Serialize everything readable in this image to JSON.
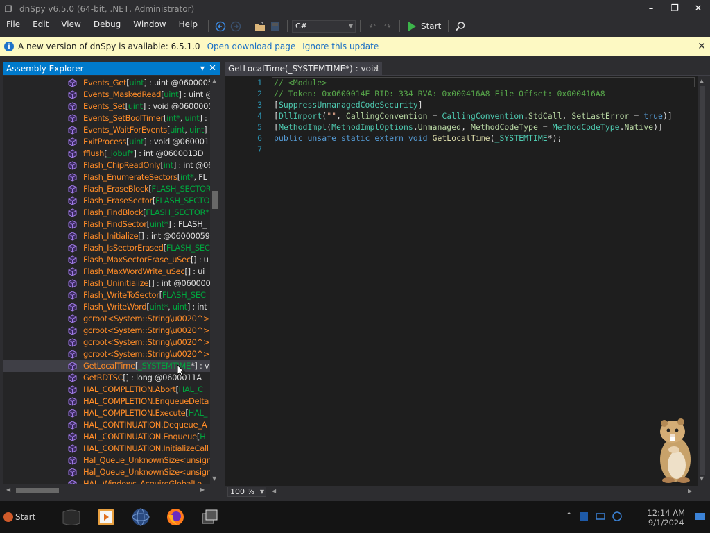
{
  "window": {
    "title": "dnSpy v6.5.0 (64-bit, .NET, Administrator)",
    "minimize": "–",
    "maximize": "❐",
    "close": "✕"
  },
  "menu": [
    "File",
    "Edit",
    "View",
    "Debug",
    "Window",
    "Help"
  ],
  "toolbar": {
    "language": "C#",
    "start_label": "Start"
  },
  "infobar": {
    "message": "A new version of dnSpy is available: 6.5.1.0",
    "download_link": "Open download page",
    "ignore_link": "Ignore this update"
  },
  "assembly_explorer": {
    "title": "Assembly Explorer",
    "rows": [
      {
        "parts": [
          [
            "o",
            "Events_Get"
          ],
          [
            "w",
            "["
          ],
          [
            "g",
            "uint"
          ],
          [
            "w",
            "] : uint @0600005"
          ]
        ]
      },
      {
        "parts": [
          [
            "o",
            "Events_MaskedRead"
          ],
          [
            "w",
            "["
          ],
          [
            "g",
            "uint"
          ],
          [
            "w",
            "] : uint @"
          ]
        ]
      },
      {
        "parts": [
          [
            "o",
            "Events_Set"
          ],
          [
            "w",
            "["
          ],
          [
            "g",
            "uint"
          ],
          [
            "w",
            "] : void @0600005"
          ]
        ]
      },
      {
        "parts": [
          [
            "o",
            "Events_SetBoolTimer"
          ],
          [
            "w",
            "["
          ],
          [
            "g",
            "int*"
          ],
          [
            "w",
            ", "
          ],
          [
            "g",
            "uint"
          ],
          [
            "w",
            "] :"
          ]
        ]
      },
      {
        "parts": [
          [
            "o",
            "Events_WaitForEvents"
          ],
          [
            "w",
            "["
          ],
          [
            "g",
            "uint"
          ],
          [
            "w",
            ", "
          ],
          [
            "g",
            "uint"
          ],
          [
            "w",
            "] :"
          ]
        ]
      },
      {
        "parts": [
          [
            "o",
            "ExitProcess"
          ],
          [
            "w",
            "["
          ],
          [
            "g",
            "uint"
          ],
          [
            "w",
            "] : void @060001"
          ]
        ]
      },
      {
        "parts": [
          [
            "o",
            "fflush"
          ],
          [
            "w",
            "["
          ],
          [
            "g",
            "_iobuf*"
          ],
          [
            "w",
            "] : int @0600013D"
          ]
        ]
      },
      {
        "parts": [
          [
            "o",
            "Flash_ChipReadOnly"
          ],
          [
            "w",
            "["
          ],
          [
            "g",
            "int"
          ],
          [
            "w",
            "] : int @06"
          ]
        ]
      },
      {
        "parts": [
          [
            "o",
            "Flash_EnumerateSectors"
          ],
          [
            "w",
            "["
          ],
          [
            "g",
            "int*"
          ],
          [
            "w",
            ", FL"
          ]
        ]
      },
      {
        "parts": [
          [
            "o",
            "Flash_EraseBlock"
          ],
          [
            "w",
            "["
          ],
          [
            "g",
            "FLASH_SECTOR"
          ]
        ]
      },
      {
        "parts": [
          [
            "o",
            "Flash_EraseSector"
          ],
          [
            "w",
            "["
          ],
          [
            "g",
            "FLASH_SECTO"
          ]
        ]
      },
      {
        "parts": [
          [
            "o",
            "Flash_FindBlock"
          ],
          [
            "w",
            "["
          ],
          [
            "g",
            "FLASH_SECTOR*"
          ]
        ]
      },
      {
        "parts": [
          [
            "o",
            "Flash_FindSector"
          ],
          [
            "w",
            "["
          ],
          [
            "g",
            "uint*"
          ],
          [
            "w",
            "] : FLASH_"
          ]
        ]
      },
      {
        "parts": [
          [
            "o",
            "Flash_Initialize"
          ],
          [
            "w",
            "[] : int @06000059"
          ]
        ]
      },
      {
        "parts": [
          [
            "o",
            "Flash_IsSectorErased"
          ],
          [
            "w",
            "["
          ],
          [
            "g",
            "FLASH_SEC"
          ]
        ]
      },
      {
        "parts": [
          [
            "o",
            "Flash_MaxSectorErase_uSec"
          ],
          [
            "w",
            "[] : u"
          ]
        ]
      },
      {
        "parts": [
          [
            "o",
            "Flash_MaxWordWrite_uSec"
          ],
          [
            "w",
            "[] : ui"
          ]
        ]
      },
      {
        "parts": [
          [
            "o",
            "Flash_Uninitialize"
          ],
          [
            "w",
            "[] : int @0600000"
          ]
        ]
      },
      {
        "parts": [
          [
            "o",
            "Flash_WriteToSector"
          ],
          [
            "w",
            "["
          ],
          [
            "g",
            "FLASH_SEC"
          ]
        ]
      },
      {
        "parts": [
          [
            "o",
            "Flash_WriteWord"
          ],
          [
            "w",
            "["
          ],
          [
            "g",
            "uint*"
          ],
          [
            "w",
            ", "
          ],
          [
            "g",
            "uint"
          ],
          [
            "w",
            "] : int"
          ]
        ]
      },
      {
        "parts": [
          [
            "o",
            "gcroot<System::String\\u0020^>"
          ]
        ]
      },
      {
        "parts": [
          [
            "o",
            "gcroot<System::String\\u0020^>."
          ]
        ]
      },
      {
        "parts": [
          [
            "o",
            "gcroot<System::String\\u0020^>"
          ]
        ]
      },
      {
        "parts": [
          [
            "o",
            "gcroot<System::String\\u0020^>."
          ]
        ]
      },
      {
        "parts": [
          [
            "o",
            "GetLocalTime"
          ],
          [
            "w",
            "["
          ],
          [
            "g",
            "_SYSTEMTIME"
          ],
          [
            "w",
            "*] : v"
          ]
        ],
        "selected": true
      },
      {
        "parts": [
          [
            "o",
            "GetRDTSC"
          ],
          [
            "w",
            "[] : long @0600011A"
          ]
        ]
      },
      {
        "parts": [
          [
            "o",
            "HAL_COMPLETION.Abort"
          ],
          [
            "w",
            "["
          ],
          [
            "g",
            "HAL_C"
          ]
        ]
      },
      {
        "parts": [
          [
            "o",
            "HAL_COMPLETION.EnqueueDelta"
          ]
        ]
      },
      {
        "parts": [
          [
            "o",
            "HAL_COMPLETION.Execute"
          ],
          [
            "w",
            "["
          ],
          [
            "g",
            "HAL_"
          ]
        ]
      },
      {
        "parts": [
          [
            "o",
            "HAL_CONTINUATION.Dequeue_A"
          ]
        ]
      },
      {
        "parts": [
          [
            "o",
            "HAL_CONTINUATION.Enqueue"
          ],
          [
            "w",
            "["
          ],
          [
            "g",
            "H"
          ]
        ]
      },
      {
        "parts": [
          [
            "o",
            "HAL_CONTINUATION.InitializeCall"
          ]
        ]
      },
      {
        "parts": [
          [
            "o",
            "Hal_Queue_UnknownSize<unsign"
          ]
        ]
      },
      {
        "parts": [
          [
            "o",
            "Hal_Queue_UnknownSize<unsign"
          ]
        ]
      },
      {
        "parts": [
          [
            "o",
            "HAL_Windows_AcquireGlobalLo"
          ]
        ]
      }
    ]
  },
  "document_tab": {
    "title": "GetLocalTime(_SYSTEMTIME*) : void",
    "close": "✕"
  },
  "code": {
    "lines": [
      {
        "n": "1",
        "tokens": [
          [
            "com",
            "// <Module>"
          ]
        ]
      },
      {
        "n": "2",
        "tokens": [
          [
            "com",
            "// Token: 0x0600014E RID: 334 RVA: 0x000416A8 File Offset: 0x000416A8"
          ]
        ]
      },
      {
        "n": "3",
        "tokens": [
          [
            "def",
            "["
          ],
          [
            "teal",
            "SuppressUnmanagedCodeSecurity"
          ],
          [
            "def",
            "]"
          ]
        ]
      },
      {
        "n": "4",
        "tokens": [
          [
            "def",
            "["
          ],
          [
            "teal",
            "DllImport"
          ],
          [
            "def",
            "("
          ],
          [
            "str",
            "\"\""
          ],
          [
            "def",
            ", "
          ],
          [
            "purple",
            "CallingConvention"
          ],
          [
            "def",
            " = "
          ],
          [
            "teal",
            "CallingConvention"
          ],
          [
            "def",
            "."
          ],
          [
            "enum",
            "StdCall"
          ],
          [
            "def",
            ", "
          ],
          [
            "purple",
            "SetLastError"
          ],
          [
            "def",
            " = "
          ],
          [
            "blue",
            "true"
          ],
          [
            "def",
            ")]"
          ]
        ]
      },
      {
        "n": "5",
        "tokens": [
          [
            "def",
            "["
          ],
          [
            "teal",
            "MethodImpl"
          ],
          [
            "def",
            "("
          ],
          [
            "teal",
            "MethodImplOptions"
          ],
          [
            "def",
            "."
          ],
          [
            "enum",
            "Unmanaged"
          ],
          [
            "def",
            ", "
          ],
          [
            "purple",
            "MethodCodeType"
          ],
          [
            "def",
            " = "
          ],
          [
            "teal",
            "MethodCodeType"
          ],
          [
            "def",
            "."
          ],
          [
            "enum",
            "Native"
          ],
          [
            "def",
            ")]"
          ]
        ]
      },
      {
        "n": "6",
        "tokens": [
          [
            "blue",
            "public unsafe static extern void "
          ],
          [
            "meth",
            "GetLocalTime"
          ],
          [
            "def",
            "("
          ],
          [
            "green",
            "_SYSTEMTIME"
          ],
          [
            "def",
            "*);"
          ]
        ]
      },
      {
        "n": "7",
        "tokens": []
      }
    ]
  },
  "editor": {
    "zoom": "100 %"
  },
  "taskbar": {
    "start": "Start",
    "time": "12:14 AM",
    "date": "9/1/2024"
  }
}
